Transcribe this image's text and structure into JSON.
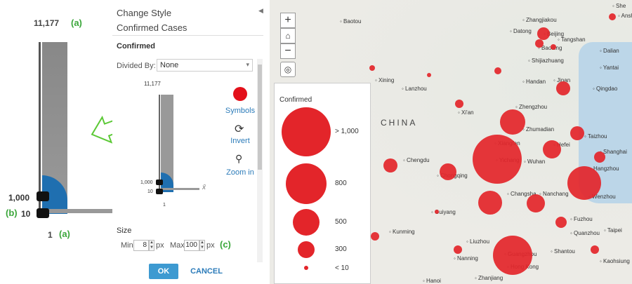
{
  "zoom": {
    "max_label": "11,177",
    "max_marker": "(a)",
    "mid_label": "1,000",
    "low_label": "10",
    "low_marker": "(b)",
    "min_label": "1",
    "min_marker": "(a)",
    "xbar": "x̄"
  },
  "panel": {
    "title": "Change Style",
    "subtitle": "Confirmed Cases",
    "section": "Confirmed",
    "divided_by_label": "Divided By:",
    "divided_by_value": "None",
    "slider_max": "11,177",
    "slider_mid": "1,000",
    "slider_low": "10",
    "slider_min": "1",
    "xbar": "x̄",
    "symbols_label": "Symbols",
    "invert_label": "Invert",
    "zoom_label": "Zoom in",
    "size_label": "Size",
    "min_label": "Min",
    "min_value": "8",
    "max_label": "Max",
    "max_value": "100",
    "px": "px",
    "c_marker": "(c)",
    "ok_label": "OK",
    "cancel_label": "CANCEL"
  },
  "legend": {
    "title": "Confirmed",
    "items": [
      "> 1,000",
      "800",
      "500",
      "300",
      "< 10"
    ]
  },
  "map": {
    "country_label": "CHINA",
    "zoom_in": "+",
    "zoom_out": "−",
    "cities": [
      "She",
      "Ansha",
      "Baotou",
      "Zhangjiakou",
      "Datong",
      "Beijing",
      "Tangshan",
      "Baoding",
      "Dalian",
      "Shijiazhuang",
      "Yantai",
      "Xining",
      "Lanzhou",
      "Handan",
      "Jinan",
      "Qingdao",
      "Xi'an",
      "Zhengzhou",
      "Zhumadian",
      "Taizhou",
      "Xiangfan",
      "Hefei",
      "Shanghai",
      "Chengdu",
      "Yichang",
      "Wuhan",
      "Hangzhou",
      "Chongqing",
      "Changsha",
      "Nanchang",
      "Wenzhou",
      "Guiyang",
      "Fuzhou",
      "Kunming",
      "Quanzhou",
      "Taipei",
      "Liuzhou",
      "Shantou",
      "Nanning",
      "Guangzhou",
      "Hong Kong",
      "Kaohsiung",
      "Hanoi",
      "Zhanjiang"
    ]
  },
  "colors": {
    "bubble": "#e3252a",
    "accent": "#2b7bb9",
    "annotation": "#3aa63a",
    "symbol_blue": "#1f6fb0"
  }
}
